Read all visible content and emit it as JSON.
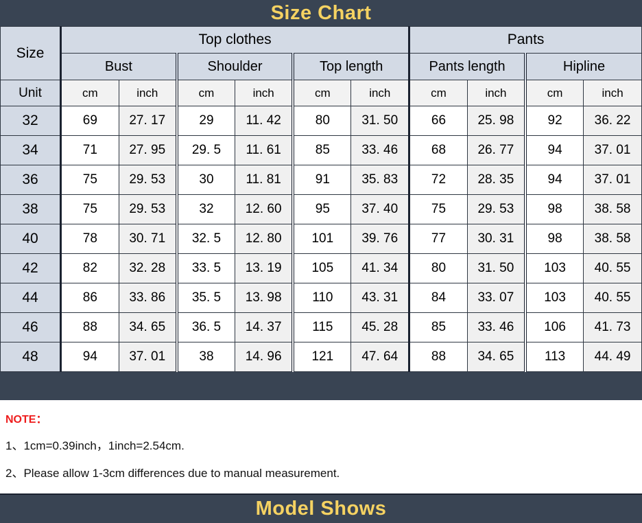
{
  "title_banner": {
    "text": "Size Chart"
  },
  "bottom_banner": {
    "text": "Model Shows"
  },
  "table": {
    "size_header": "Size",
    "unit_header": "Unit",
    "groups": [
      {
        "label": "Top clothes",
        "span": 6
      },
      {
        "label": "Pants",
        "span": 4
      }
    ],
    "measurements": [
      "Bust",
      "Shoulder",
      "Top length",
      "Pants length",
      "Hipline"
    ],
    "units": [
      "cm",
      "inch",
      "cm",
      "inch",
      "cm",
      "inch",
      "cm",
      "inch",
      "cm",
      "inch"
    ],
    "rows": [
      {
        "size": "32",
        "values": [
          "69",
          "27. 17",
          "29",
          "11. 42",
          "80",
          "31. 50",
          "66",
          "25. 98",
          "92",
          "36. 22"
        ]
      },
      {
        "size": "34",
        "values": [
          "71",
          "27. 95",
          "29. 5",
          "11. 61",
          "85",
          "33. 46",
          "68",
          "26. 77",
          "94",
          "37. 01"
        ]
      },
      {
        "size": "36",
        "values": [
          "75",
          "29. 53",
          "30",
          "11. 81",
          "91",
          "35. 83",
          "72",
          "28. 35",
          "94",
          "37. 01"
        ]
      },
      {
        "size": "38",
        "values": [
          "75",
          "29. 53",
          "32",
          "12. 60",
          "95",
          "37. 40",
          "75",
          "29. 53",
          "98",
          "38. 58"
        ]
      },
      {
        "size": "40",
        "values": [
          "78",
          "30. 71",
          "32. 5",
          "12. 80",
          "101",
          "39. 76",
          "77",
          "30. 31",
          "98",
          "38. 58"
        ]
      },
      {
        "size": "42",
        "values": [
          "82",
          "32. 28",
          "33. 5",
          "13. 19",
          "105",
          "41. 34",
          "80",
          "31. 50",
          "103",
          "40. 55"
        ]
      },
      {
        "size": "44",
        "values": [
          "86",
          "33. 86",
          "35. 5",
          "13. 98",
          "110",
          "43. 31",
          "84",
          "33. 07",
          "103",
          "40. 55"
        ]
      },
      {
        "size": "46",
        "values": [
          "88",
          "34. 65",
          "36. 5",
          "14. 37",
          "115",
          "45. 28",
          "85",
          "33. 46",
          "106",
          "41. 73"
        ]
      },
      {
        "size": "48",
        "values": [
          "94",
          "37. 01",
          "38",
          "14. 96",
          "121",
          "47. 64",
          "88",
          "34. 65",
          "113",
          "44. 49"
        ]
      }
    ]
  },
  "notes": {
    "title": "NOTE：",
    "lines": [
      "1、1cm=0.39inch，1inch=2.54cm.",
      "2、Please allow 1-3cm differences due to manual measurement."
    ]
  },
  "colors": {
    "banner_bg": "#394453",
    "banner_text": "#f5d262",
    "header_bg": "#d3dae5",
    "inch_cell_bg": "#f0f0f0",
    "note_title": "#ee1c1c"
  },
  "chart_data": {
    "type": "table",
    "title": "Size Chart",
    "categories": [
      "32",
      "34",
      "36",
      "38",
      "40",
      "42",
      "44",
      "46",
      "48"
    ],
    "columns": [
      "Size",
      "Bust cm",
      "Bust inch",
      "Shoulder cm",
      "Shoulder inch",
      "Top length cm",
      "Top length inch",
      "Pants length cm",
      "Pants length inch",
      "Hipline cm",
      "Hipline inch"
    ],
    "series": [
      {
        "name": "Bust cm",
        "values": [
          69,
          71,
          75,
          75,
          78,
          82,
          86,
          88,
          94
        ]
      },
      {
        "name": "Bust inch",
        "values": [
          27.17,
          27.95,
          29.53,
          29.53,
          30.71,
          32.28,
          33.86,
          34.65,
          37.01
        ]
      },
      {
        "name": "Shoulder cm",
        "values": [
          29,
          29.5,
          30,
          32,
          32.5,
          33.5,
          35.5,
          36.5,
          38
        ]
      },
      {
        "name": "Shoulder inch",
        "values": [
          11.42,
          11.61,
          11.81,
          12.6,
          12.8,
          13.19,
          13.98,
          14.37,
          14.96
        ]
      },
      {
        "name": "Top length cm",
        "values": [
          80,
          85,
          91,
          95,
          101,
          105,
          110,
          115,
          121
        ]
      },
      {
        "name": "Top length inch",
        "values": [
          31.5,
          33.46,
          35.83,
          37.4,
          39.76,
          41.34,
          43.31,
          45.28,
          47.64
        ]
      },
      {
        "name": "Pants length cm",
        "values": [
          66,
          68,
          72,
          75,
          77,
          80,
          84,
          85,
          88
        ]
      },
      {
        "name": "Pants length inch",
        "values": [
          25.98,
          26.77,
          28.35,
          29.53,
          30.31,
          31.5,
          33.07,
          33.46,
          34.65
        ]
      },
      {
        "name": "Hipline cm",
        "values": [
          92,
          94,
          94,
          98,
          98,
          103,
          103,
          106,
          113
        ]
      },
      {
        "name": "Hipline inch",
        "values": [
          36.22,
          37.01,
          37.01,
          38.58,
          38.58,
          40.55,
          40.55,
          41.73,
          44.49
        ]
      }
    ],
    "xlabel": "Size",
    "ylabel": "",
    "grid": true,
    "legend": "none"
  }
}
